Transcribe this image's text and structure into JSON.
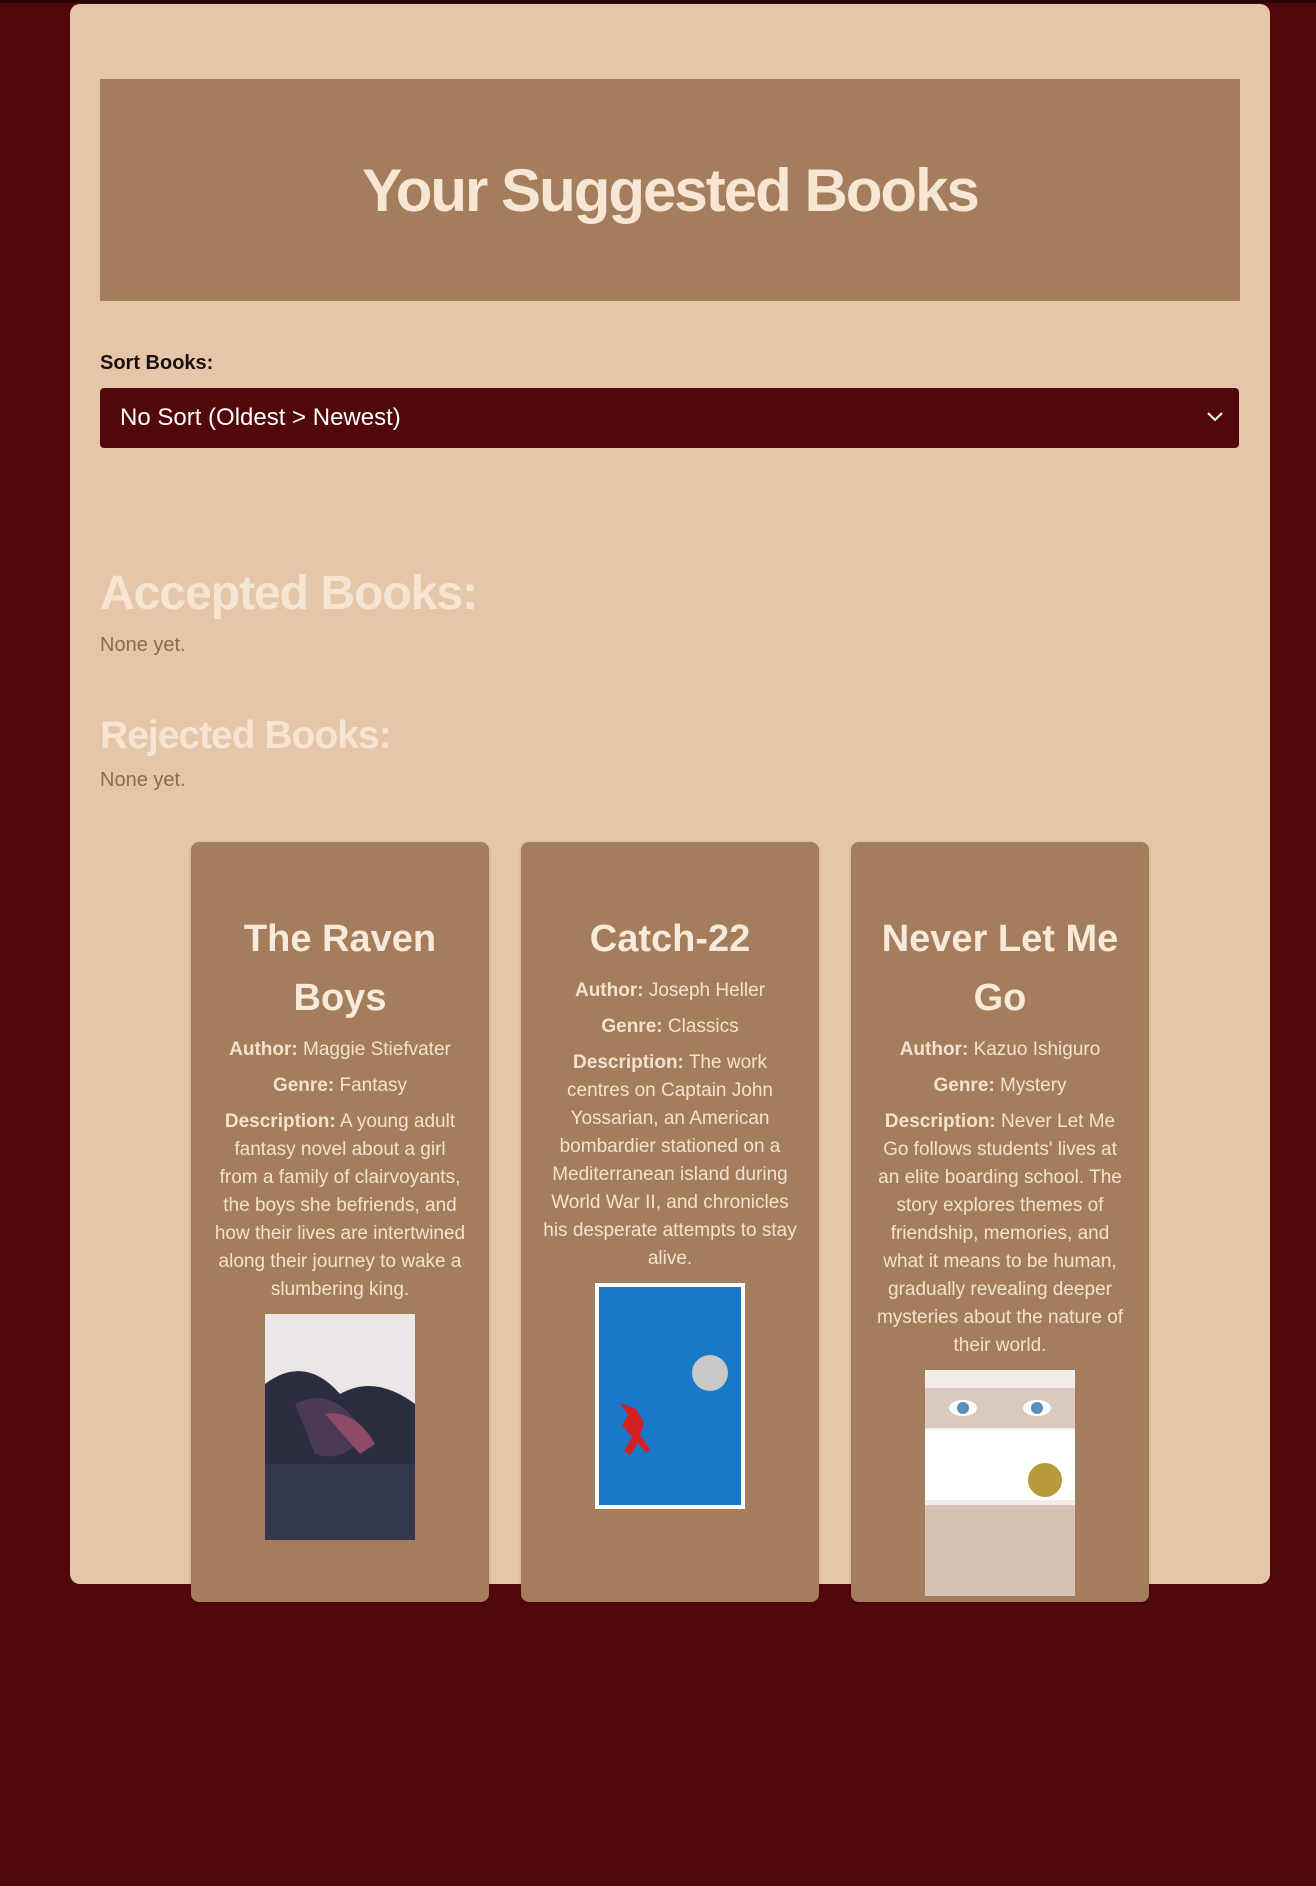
{
  "page": {
    "title": "Your Suggested Books"
  },
  "sort": {
    "label": "Sort Books:",
    "selected": "No Sort (Oldest > Newest)"
  },
  "accepted": {
    "title": "Accepted Books:",
    "empty_text": "None yet."
  },
  "rejected": {
    "title": "Rejected Books:",
    "empty_text": "None yet."
  },
  "labels": {
    "author": "Author:",
    "genre": "Genre:",
    "description": "Description:"
  },
  "books": [
    {
      "title": "The Raven Boys",
      "author": "Maggie Stiefvater",
      "genre": "Fantasy",
      "description": "A young adult fantasy novel about a girl from a family of clairvoyants, the boys she befriends, and how their lives are intertwined along their journey to wake a slumbering king."
    },
    {
      "title": "Catch-22",
      "author": "Joseph Heller",
      "genre": "Classics",
      "description": "The work centres on Captain John Yossarian, an American bombardier stationed on a Mediterranean island during World War II, and chronicles his desperate attempts to stay alive."
    },
    {
      "title": "Never Let Me Go",
      "author": "Kazuo Ishiguro",
      "genre": "Mystery",
      "description": "Never Let Me Go follows students' lives at an elite boarding school. The story explores themes of friendship, memories, and what it means to be human, gradually revealing deeper mysteries about the nature of their world."
    }
  ],
  "colors": {
    "page_bg": "#52080b",
    "panel_bg": "#e6c6a8",
    "accent_brown": "#a47e5c",
    "heading_cream": "#f6e5d3"
  }
}
